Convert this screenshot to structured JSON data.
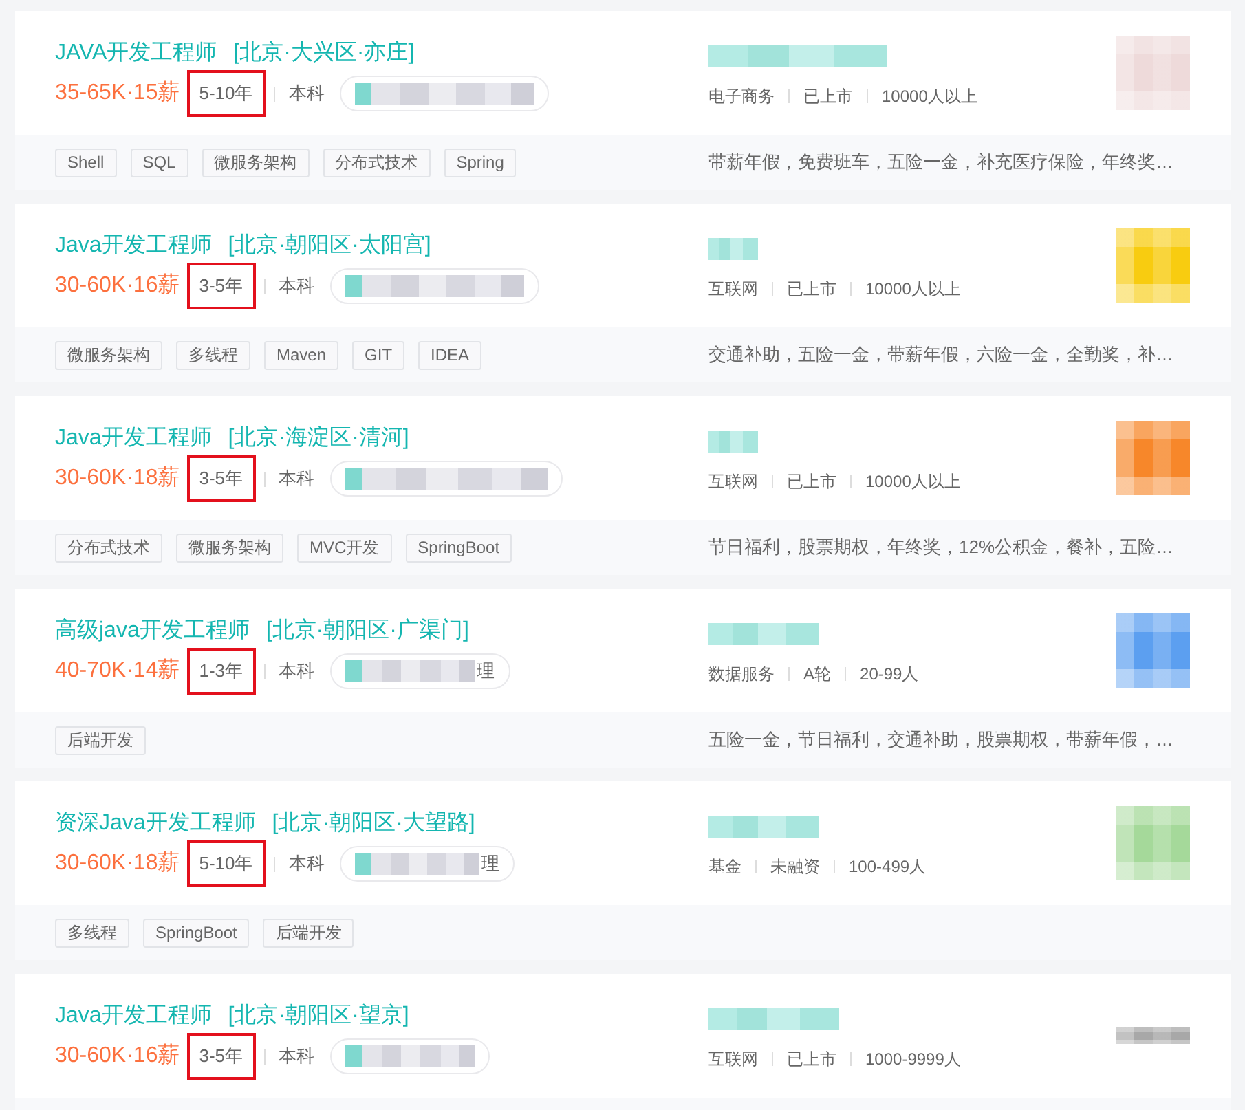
{
  "jobs": [
    {
      "title": "JAVA开发工程师",
      "location": "[北京·大兴区·亦庄]",
      "salary": "35-65K·15薪",
      "experience": "5-10年",
      "experience_highlighted": true,
      "education": "本科",
      "company": {
        "industry": "电子商务",
        "financing": "已上市",
        "size": "10000人以上"
      },
      "logo": {
        "kind": "square",
        "color": "#eedada"
      },
      "tags": [
        "Shell",
        "SQL",
        "微服务架构",
        "分布式技术",
        "Spring"
      ],
      "benefits": "带薪年假，免费班车，五险一金，补充医疗保险，年终奖…"
    },
    {
      "title": "Java开发工程师",
      "location": "[北京·朝阳区·太阳宫]",
      "salary": "30-60K·16薪",
      "experience": "3-5年",
      "experience_highlighted": true,
      "education": "本科",
      "company": {
        "industry": "互联网",
        "financing": "已上市",
        "size": "10000人以上"
      },
      "logo": {
        "kind": "square",
        "color": "#f8cc10"
      },
      "tags": [
        "微服务架构",
        "多线程",
        "Maven",
        "GIT",
        "IDEA"
      ],
      "benefits": "交通补助，五险一金，带薪年假，六险一金，全勤奖，补…"
    },
    {
      "title": "Java开发工程师",
      "location": "[北京·海淀区·清河]",
      "salary": "30-60K·18薪",
      "experience": "3-5年",
      "experience_highlighted": true,
      "education": "本科",
      "company": {
        "industry": "互联网",
        "financing": "已上市",
        "size": "10000人以上"
      },
      "logo": {
        "kind": "square",
        "color": "#f7872a"
      },
      "tags": [
        "分布式技术",
        "微服务架构",
        "MVC开发",
        "SpringBoot"
      ],
      "benefits": "节日福利，股票期权，年终奖，12%公积金，餐补，五险…"
    },
    {
      "title": "高级java开发工程师",
      "location": "[北京·朝阳区·广渠门]",
      "salary": "40-70K·14薪",
      "experience": "1-3年",
      "experience_highlighted": true,
      "education": "本科",
      "recruiter_suffix": "理",
      "company": {
        "industry": "数据服务",
        "financing": "A轮",
        "size": "20-99人"
      },
      "logo": {
        "kind": "square",
        "color": "#5c9ff0"
      },
      "tags": [
        "后端开发"
      ],
      "benefits": "五险一金，节日福利，交通补助，股票期权，带薪年假，…"
    },
    {
      "title": "资深Java开发工程师",
      "location": "[北京·朝阳区·大望路]",
      "salary": "30-60K·18薪",
      "experience": "5-10年",
      "experience_highlighted": true,
      "education": "本科",
      "recruiter_suffix": "理",
      "company": {
        "industry": "基金",
        "financing": "未融资",
        "size": "100-499人"
      },
      "logo": {
        "kind": "square",
        "color": "#a5d99a"
      },
      "tags": [
        "多线程",
        "SpringBoot",
        "后端开发"
      ]
    },
    {
      "title": "Java开发工程师",
      "location": "[北京·朝阳区·望京]",
      "salary": "30-60K·16薪",
      "experience": "3-5年",
      "experience_highlighted": true,
      "education": "本科",
      "company": {
        "industry": "互联网",
        "financing": "已上市",
        "size": "1000-9999人"
      },
      "logo": {
        "kind": "wide",
        "color": "#a8a8a8"
      }
    }
  ]
}
